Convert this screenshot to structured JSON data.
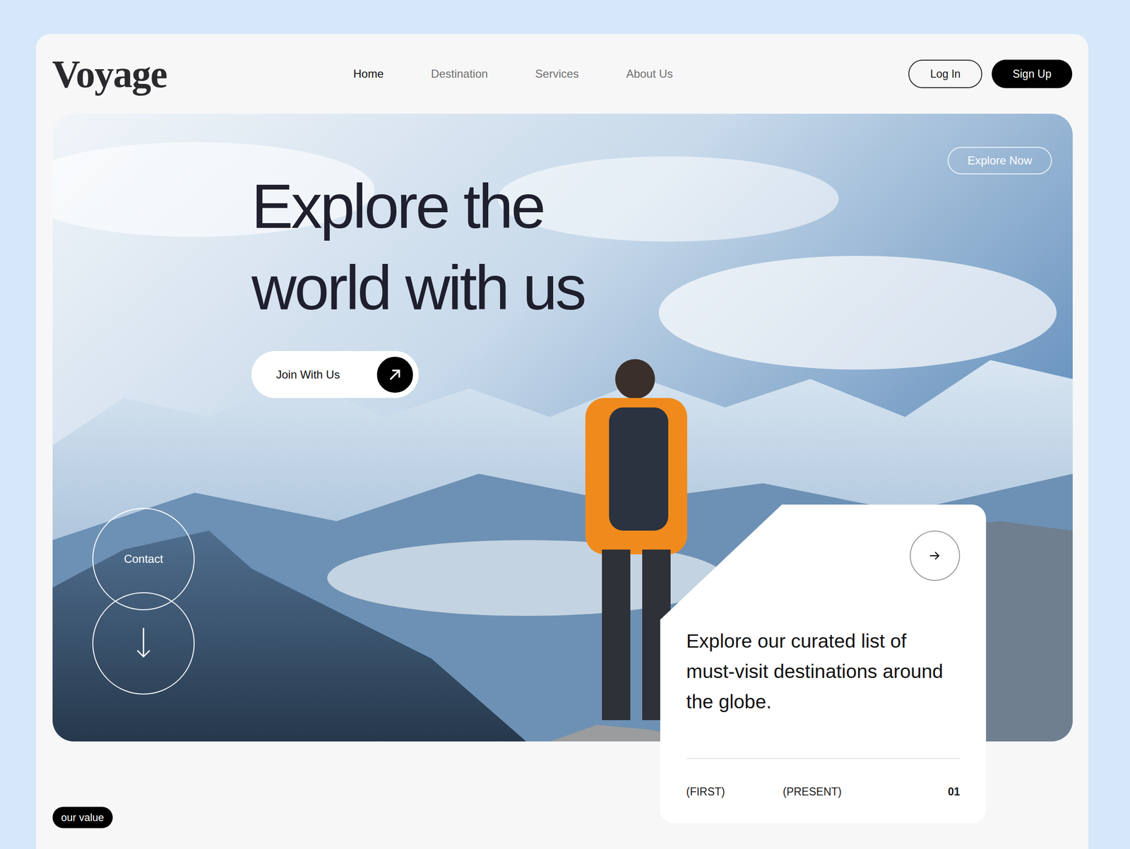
{
  "brand": "Voyage",
  "nav": [
    {
      "label": "Home",
      "selected": true
    },
    {
      "label": "Destination",
      "selected": false
    },
    {
      "label": "Services",
      "selected": false
    },
    {
      "label": "About Us",
      "selected": false
    }
  ],
  "auth": {
    "login": "Log In",
    "signup": "Sign Up"
  },
  "hero": {
    "headline": [
      "Explore the",
      "world with us"
    ],
    "cta": "Join With Us",
    "explore_now": "Explore Now",
    "contact": "Contact"
  },
  "card": {
    "text": "Explore our curated list of must-visit destinations around the globe.",
    "footer": [
      "(FIRST)",
      "(PRESENT)",
      "01"
    ]
  },
  "badge": "our value"
}
